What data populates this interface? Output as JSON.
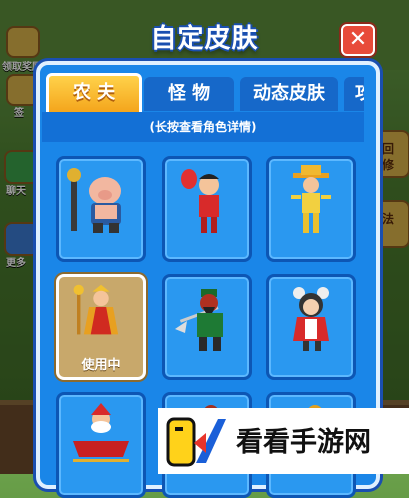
{
  "background": {
    "side_labels": [
      "领取奖励",
      "签",
      "聊天",
      "更多"
    ],
    "right_labels": [
      "回",
      "修",
      "法"
    ]
  },
  "dialog": {
    "title": "自定皮肤",
    "close_icon": "close-icon",
    "tabs": [
      {
        "label": "农 夫",
        "active": true
      },
      {
        "label": "怪 物",
        "active": false
      },
      {
        "label": "动态皮肤",
        "active": false
      },
      {
        "label": "攻",
        "active": false
      }
    ],
    "hint": "(长按查看角色详情)",
    "skins": [
      {
        "name": "pig-warrior-skin",
        "in_use": false
      },
      {
        "name": "red-suit-man-skin",
        "in_use": false
      },
      {
        "name": "yellow-cowboy-skin",
        "in_use": false
      },
      {
        "name": "tang-monk-skin",
        "in_use": true
      },
      {
        "name": "guan-yu-general-skin",
        "in_use": false
      },
      {
        "name": "red-hood-girl-skin",
        "in_use": false
      },
      {
        "name": "santa-sleigh-skin",
        "in_use": false
      },
      {
        "name": "partial-skin-8",
        "in_use": false
      },
      {
        "name": "partial-skin-9",
        "in_use": false
      }
    ],
    "in_use_label": "使用中"
  },
  "watermark": {
    "text": "看看手游网",
    "logo_icon": "kk-logo-icon"
  },
  "colors": {
    "panel": "#1a86e8",
    "card": "#2a98f0",
    "tab_active": "#f4a51c",
    "close": "#e84b3a"
  }
}
